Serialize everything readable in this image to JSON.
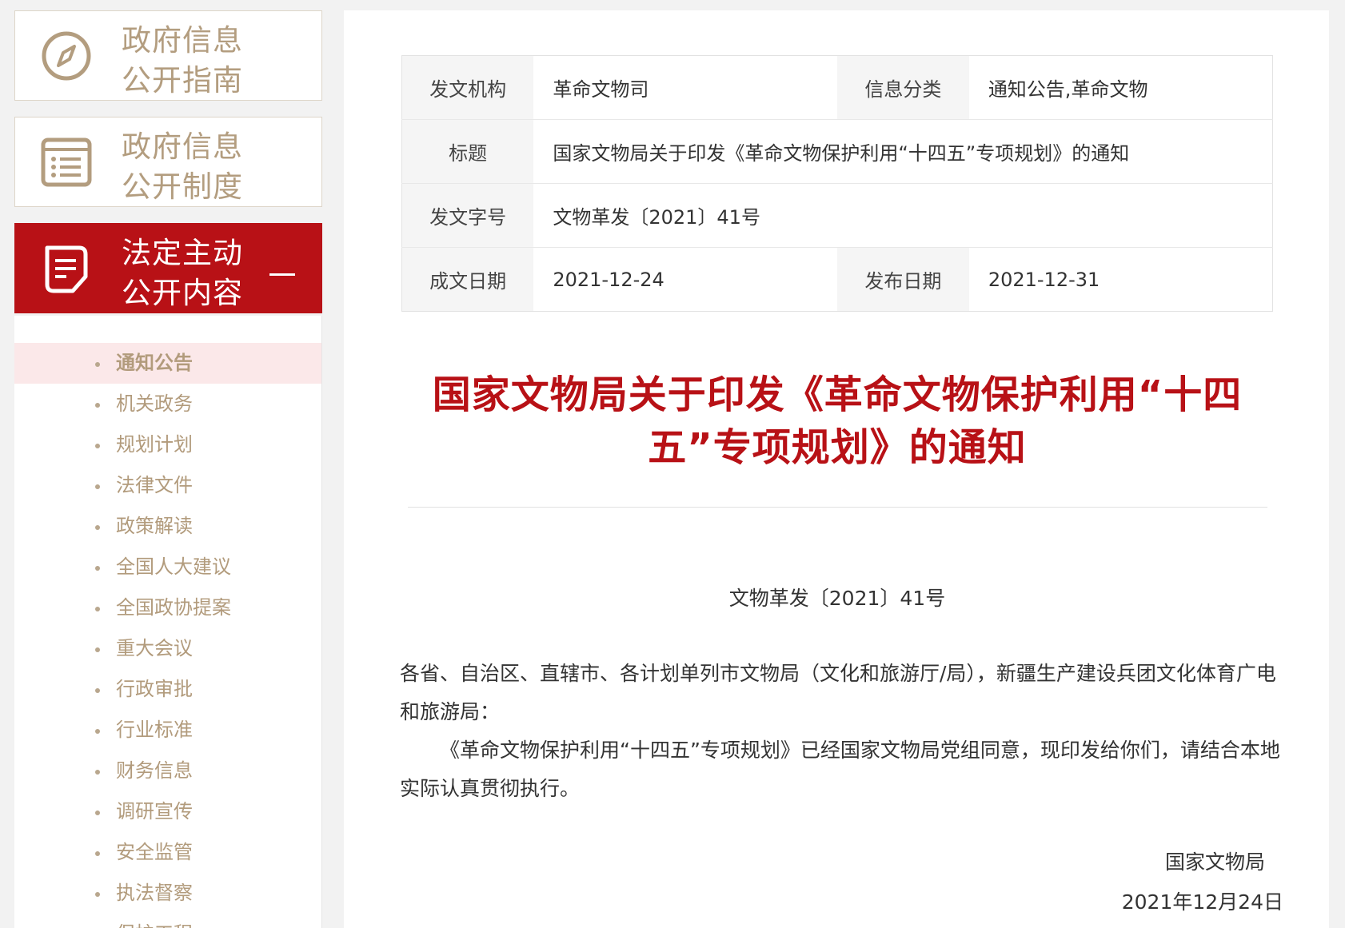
{
  "sidebar": {
    "cards": [
      {
        "line1": "政府信息",
        "line2": "公开指南"
      },
      {
        "line1": "政府信息",
        "line2": "公开制度"
      },
      {
        "line1": "法定主动",
        "line2": "公开内容"
      }
    ],
    "subnav": [
      "通知公告",
      "机关政务",
      "规划计划",
      "法律文件",
      "政策解读",
      "全国人大建议",
      "全国政协提案",
      "重大会议",
      "行政审批",
      "行业标准",
      "财务信息",
      "调研宣传",
      "安全监管",
      "执法督察",
      "保护工程"
    ],
    "accent": "#b81116",
    "muted": "#b39d7f"
  },
  "meta": {
    "issuer_key": "发文机构",
    "issuer": "革命文物司",
    "category_key": "信息分类",
    "category": "通知公告,革命文物",
    "title_key": "标题",
    "title": "国家文物局关于印发《革命文物保护利用“十四五”专项规划》的通知",
    "docno_key": "发文字号",
    "docno": "文物革发〔2021〕41号",
    "written_key": "成文日期",
    "written": "2021-12-24",
    "published_key": "发布日期",
    "published": "2021-12-31"
  },
  "article": {
    "title_line1": "国家文物局关于印发《革命文物保护利用“十四",
    "title_line2": "五”专项规划》的通知",
    "doc_no": "文物革发〔2021〕41号",
    "salutation": "各省、自治区、直辖市、各计划单列市文物局（文化和旅游厅/局），新疆生产建设兵团文化体育广电和旅游局：",
    "paragraph": "《革命文物保护利用“十四五”专项规划》已经国家文物局党组同意，现印发给你们，请结合本地实际认真贯彻执行。",
    "signer": "国家文物局",
    "date": "2021年12月24日"
  }
}
